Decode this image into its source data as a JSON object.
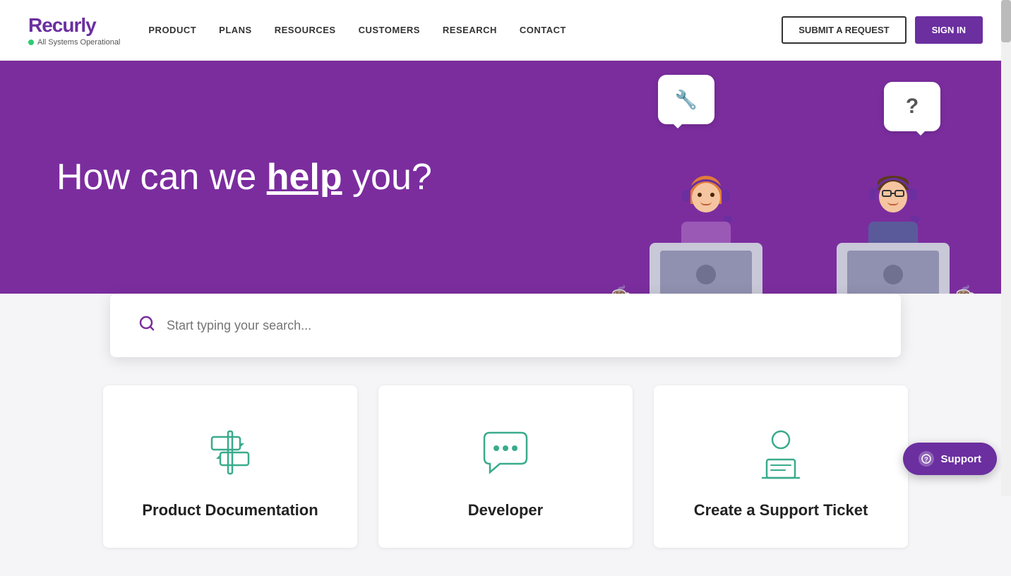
{
  "nav": {
    "logo": "Recurly",
    "status": "All Systems Operational",
    "links": [
      {
        "label": "PRODUCT",
        "id": "product"
      },
      {
        "label": "PLANS",
        "id": "plans"
      },
      {
        "label": "RESOURCES",
        "id": "resources"
      },
      {
        "label": "CUSTOMERS",
        "id": "customers"
      },
      {
        "label": "RESEARCH",
        "id": "research"
      },
      {
        "label": "CONTACT",
        "id": "contact"
      }
    ],
    "submit_btn": "SUBMIT A REQUEST",
    "signin_btn": "SIGN IN"
  },
  "hero": {
    "heading_start": "How can we ",
    "heading_underline": "help",
    "heading_end": " you?"
  },
  "search": {
    "placeholder": "Start typing your search..."
  },
  "cards": [
    {
      "id": "product-docs",
      "title": "Product Documentation"
    },
    {
      "id": "developer",
      "title": "Developer"
    },
    {
      "id": "support-ticket",
      "title": "Create a Support Ticket"
    }
  ],
  "support_fab": {
    "label": "Support"
  }
}
